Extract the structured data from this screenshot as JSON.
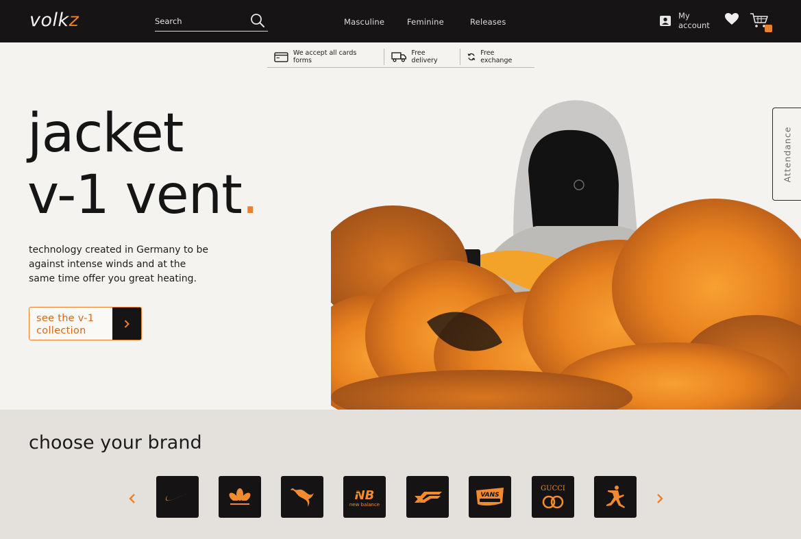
{
  "header": {
    "logo": {
      "prefix": "volk",
      "accent": "z"
    },
    "search": {
      "placeholder": "Search",
      "icon": "search-icon"
    },
    "nav": [
      {
        "label": "Masculine"
      },
      {
        "label": "Feminine"
      },
      {
        "label": "Releases"
      }
    ],
    "account": {
      "label": "My account",
      "icon": "account-icon"
    },
    "wishlist_icon": "heart-icon",
    "cart": {
      "icon": "cart-icon"
    }
  },
  "benefits": [
    {
      "label": "We accept all cards forms",
      "icon": "credit-card-icon"
    },
    {
      "label": "Free delivery",
      "icon": "truck-icon"
    },
    {
      "label": "Free exchange",
      "icon": "exchange-icon"
    }
  ],
  "hero": {
    "title_line1": "jacket",
    "title_line2": "v-1 vent",
    "title_dot": ".",
    "description": "technology created in Germany to be against intense winds and at the same time offer you great heating.",
    "cta_label": "see the v-1 collection",
    "side_tab": "Attendance"
  },
  "brands": {
    "title": "choose your brand",
    "items": [
      {
        "name": "nike",
        "icon": "nike-swoosh-icon"
      },
      {
        "name": "adidas",
        "icon": "adidas-trefoil-icon"
      },
      {
        "name": "puma",
        "icon": "puma-icon"
      },
      {
        "name": "new balance",
        "icon": "new-balance-icon",
        "text": "new balance"
      },
      {
        "name": "asics",
        "icon": "asics-icon"
      },
      {
        "name": "vans",
        "icon": "vans-icon",
        "text": "VANS"
      },
      {
        "name": "gucci",
        "icon": "gucci-icon",
        "text": "GUCCI"
      },
      {
        "name": "jordan",
        "icon": "jumpman-icon"
      }
    ]
  },
  "colors": {
    "accent": "#ee7f2b",
    "dark": "#161415",
    "background": "#f5f3ef",
    "section_bg": "#e4e1dc"
  }
}
